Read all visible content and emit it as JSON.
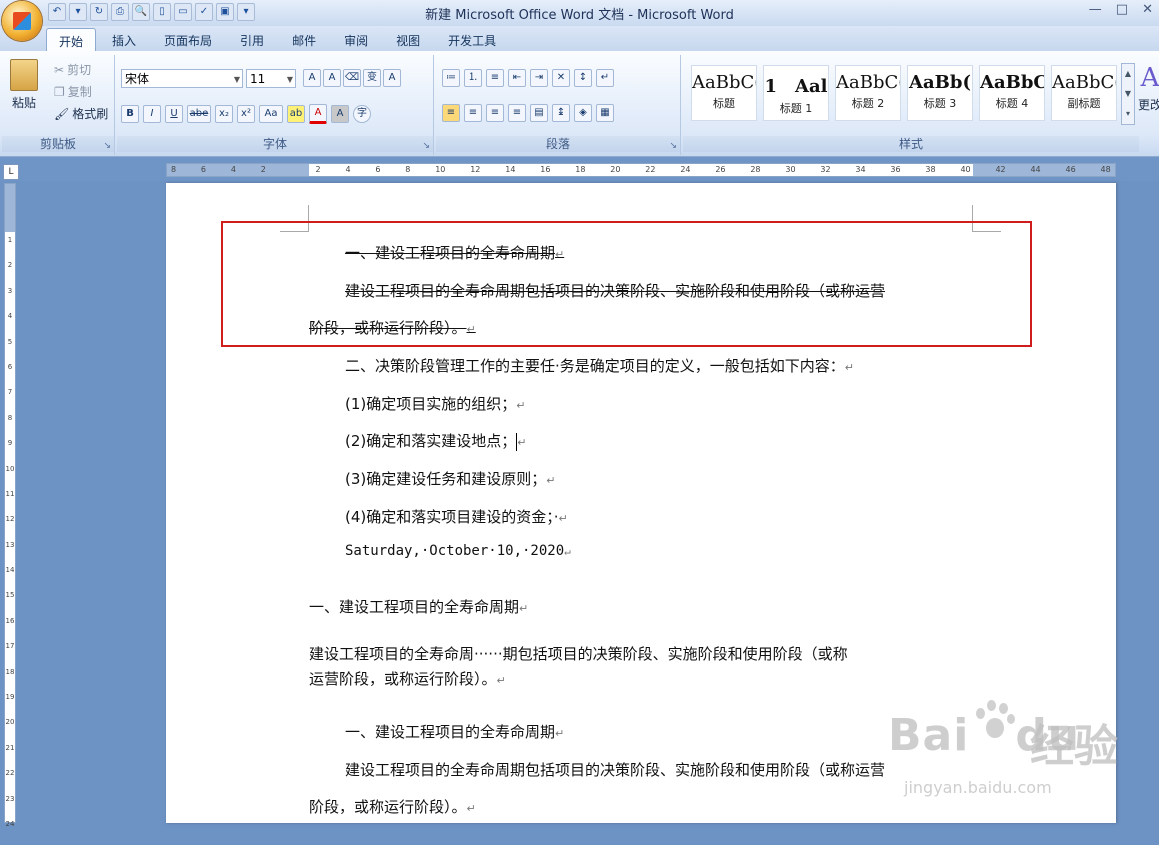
{
  "window": {
    "title": "新建 Microsoft Office Word 文档 - Microsoft Word",
    "controls": [
      "—",
      "□",
      "✕"
    ]
  },
  "qat": {
    "icons": [
      "undo-icon",
      "redo-icon",
      "print-icon",
      "preview-icon",
      "new-icon",
      "open-icon",
      "spell-icon",
      "save-icon"
    ]
  },
  "ribbon": {
    "tabs": [
      "开始",
      "插入",
      "页面布局",
      "引用",
      "邮件",
      "审阅",
      "视图",
      "开发工具"
    ],
    "active_tab": "开始",
    "clipboard": {
      "label": "剪贴板",
      "paste": "粘贴",
      "cut": "剪切",
      "copy": "复制",
      "format_painter": "格式刷"
    },
    "font": {
      "label": "字体",
      "name": "宋体",
      "size": "11",
      "bold": "B",
      "italic": "I",
      "underline": "U",
      "strike": "abe",
      "sub": "x₂",
      "sup": "x²",
      "case": "Aa",
      "grow": "A",
      "shrink": "A",
      "phonetic": "变",
      "charborder": "A",
      "charshade": "A",
      "enclose": "字"
    },
    "paragraph": {
      "label": "段落"
    },
    "styles": {
      "label": "样式",
      "items": [
        {
          "sample": "AaBbC(",
          "name": "标题"
        },
        {
          "sample": "1　Aal",
          "name": "标题 1"
        },
        {
          "sample": "AaBbC(",
          "name": "标题 2"
        },
        {
          "sample": "AaBb(",
          "name": "标题 3"
        },
        {
          "sample": "AaBbC(",
          "name": "标题 4"
        },
        {
          "sample": "AaBbC(",
          "name": "副标题"
        }
      ],
      "more": "更改"
    }
  },
  "ruler": {
    "numbers": [
      "8",
      "6",
      "4",
      "2",
      "",
      "2",
      "4",
      "6",
      "8",
      "10",
      "12",
      "14",
      "16",
      "18",
      "20",
      "22",
      "24",
      "26",
      "28",
      "30",
      "32",
      "34",
      "36",
      "38",
      "40",
      "42",
      "44",
      "46",
      "48"
    ]
  },
  "vruler": {
    "numbers": [
      "1",
      "2",
      "3",
      "4",
      "5",
      "6",
      "7",
      "8",
      "9",
      "10",
      "11",
      "12",
      "13",
      "14",
      "15",
      "16",
      "17",
      "18",
      "19",
      "20",
      "21",
      "22",
      "23",
      "24"
    ]
  },
  "document": {
    "lines": [
      "一、建设工程项目的全寿命周期",
      "建设工程项目的全寿命周期包括项目的决策阶段、实施阶段和使用阶段（或称运营",
      "阶段，或称运行阶段）。",
      "二、决策阶段管理工作的主要任·务是确定项目的定义，一般包括如下内容：",
      "(1)确定项目实施的组织；",
      "(2)确定和落实建设地点；",
      "(3)确定建设任务和建设原则；",
      "(4)确定和落实项目建设的资金；·",
      "Saturday,·October·10,·2020",
      "一、建设工程项目的全寿命周期",
      "建设工程项目的全寿命周······期包括项目的决策阶段、实施阶段和使用阶段（或称",
      "运营阶段，或称运行阶段）。",
      "一、建设工程项目的全寿命周期",
      "建设工程项目的全寿命周期包括项目的决策阶段、实施阶段和使用阶段（或称运营",
      "阶段，或称运行阶段）。"
    ],
    "mark": "↵"
  },
  "watermark": {
    "brand": "Bai",
    "brand2": "du",
    "cn": "经验",
    "url": "jingyan.baidu.com"
  }
}
